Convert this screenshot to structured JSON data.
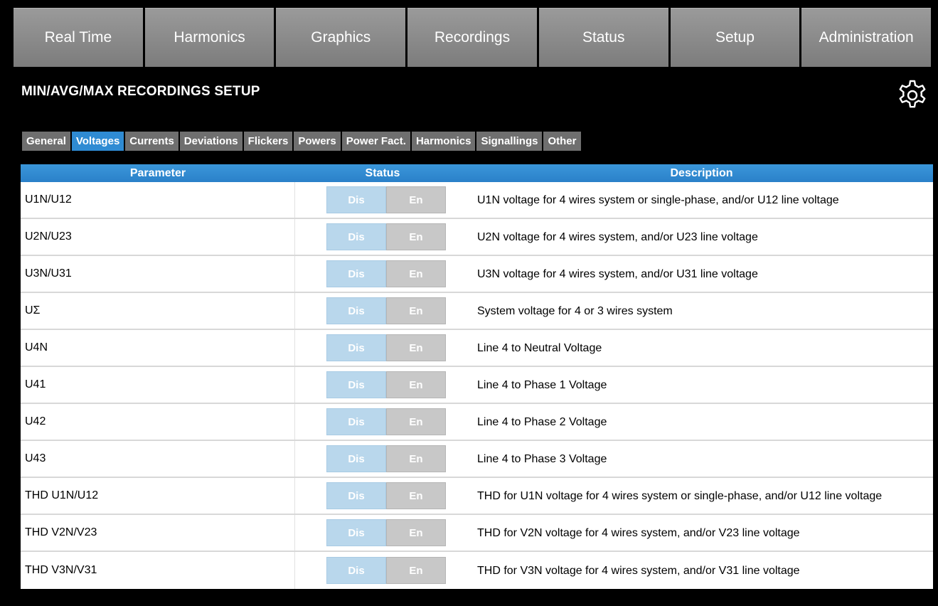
{
  "nav": {
    "tabs": [
      {
        "label": "Real Time"
      },
      {
        "label": "Harmonics"
      },
      {
        "label": "Graphics"
      },
      {
        "label": "Recordings"
      },
      {
        "label": "Status"
      },
      {
        "label": "Setup"
      },
      {
        "label": "Administration"
      }
    ]
  },
  "page": {
    "title": "MIN/AVG/MAX RECORDINGS SETUP",
    "settings_icon": "gear-icon"
  },
  "subtabs": {
    "active": "Voltages",
    "items": [
      {
        "label": "General"
      },
      {
        "label": "Voltages"
      },
      {
        "label": "Currents"
      },
      {
        "label": "Deviations"
      },
      {
        "label": "Flickers"
      },
      {
        "label": "Powers"
      },
      {
        "label": "Power Fact."
      },
      {
        "label": "Harmonics"
      },
      {
        "label": "Signallings"
      },
      {
        "label": "Other"
      }
    ]
  },
  "table": {
    "headers": {
      "parameter": "Parameter",
      "status": "Status",
      "description": "Description"
    },
    "toggle": {
      "dis_label": "Dis",
      "en_label": "En"
    },
    "rows": [
      {
        "parameter": "U1N/U12",
        "description": "U1N voltage for 4 wires system or single-phase, and/or U12 line voltage"
      },
      {
        "parameter": "U2N/U23",
        "description": "U2N voltage for 4 wires system, and/or U23 line voltage"
      },
      {
        "parameter": "U3N/U31",
        "description": "U3N voltage for 4 wires system, and/or U31 line voltage"
      },
      {
        "parameter": "UΣ",
        "description": "System voltage for 4 or 3 wires system"
      },
      {
        "parameter": "U4N",
        "description": "Line 4 to Neutral Voltage"
      },
      {
        "parameter": "U41",
        "description": "Line 4 to Phase 1 Voltage"
      },
      {
        "parameter": "U42",
        "description": "Line 4 to Phase 2 Voltage"
      },
      {
        "parameter": "U43",
        "description": "Line 4 to Phase 3 Voltage"
      },
      {
        "parameter": "THD U1N/U12",
        "description": "THD for U1N voltage for 4 wires system or single-phase, and/or U12 line voltage"
      },
      {
        "parameter": "THD V2N/V23",
        "description": "THD for V2N voltage for 4 wires system, and/or V23 line voltage"
      },
      {
        "parameter": "THD V3N/V31",
        "description": "THD for V3N voltage for 4 wires system, and/or V31 line voltage"
      }
    ]
  },
  "colors": {
    "accent": "#2f8bd3",
    "nav_bg": "#8a8a8a",
    "subtab_bg": "#6f6f6f",
    "toggle_dis": "#b9d7ec",
    "toggle_en": "#c8c8c8"
  }
}
